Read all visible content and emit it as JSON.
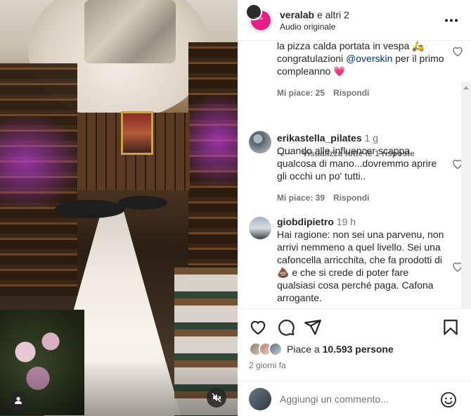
{
  "header": {
    "username": "veralab",
    "collab_suffix": "e altri 2",
    "audio": "Audio originale",
    "avatar_logo": "vera"
  },
  "comments": [
    {
      "text_parts": [
        "la pizza calda portata in vespa 🛵 congratulazioni ",
        "@overskin",
        " per il primo compleanno 💗"
      ],
      "likes": "Mi piace: 25",
      "reply": "Rispondi"
    },
    {
      "user": "erikastella_pilates",
      "time": "1 g",
      "text": "Quando alle influencer scappa qualcosa di mano...dovremmo aprire gli occhi un po' tutti..",
      "likes": "Mi piace: 39",
      "reply": "Rispondi"
    },
    {
      "user": "giobdipietro",
      "time": "19 h",
      "text": "Hai ragione: non sei una parvenu, non arrivi nemmeno a quel livello. Sei una cafoncella arricchita, che fa prodotti di 💩 e che si crede di poter fare qualsiasi cosa perché paga. Cafona arrogante."
    }
  ],
  "view_replies": "Visualizza tutte le 1 risposte",
  "likes_summary": {
    "prefix": "Piace a ",
    "count": "10.593 persone"
  },
  "post_time": "2 giorni fa",
  "add_comment": {
    "placeholder": "Aggiungi un commento..."
  },
  "icons": {
    "more": "more-dots-icon",
    "like": "heart-icon",
    "comment": "comment-bubble-icon",
    "share": "paper-plane-icon",
    "save": "bookmark-icon",
    "emoji": "smiley-icon",
    "user_tag": "person-icon",
    "mute": "speaker-muted-icon"
  },
  "colors": {
    "brand_pink": "#e91e84",
    "mention": "#00376b",
    "secondary_text": "#737373"
  }
}
